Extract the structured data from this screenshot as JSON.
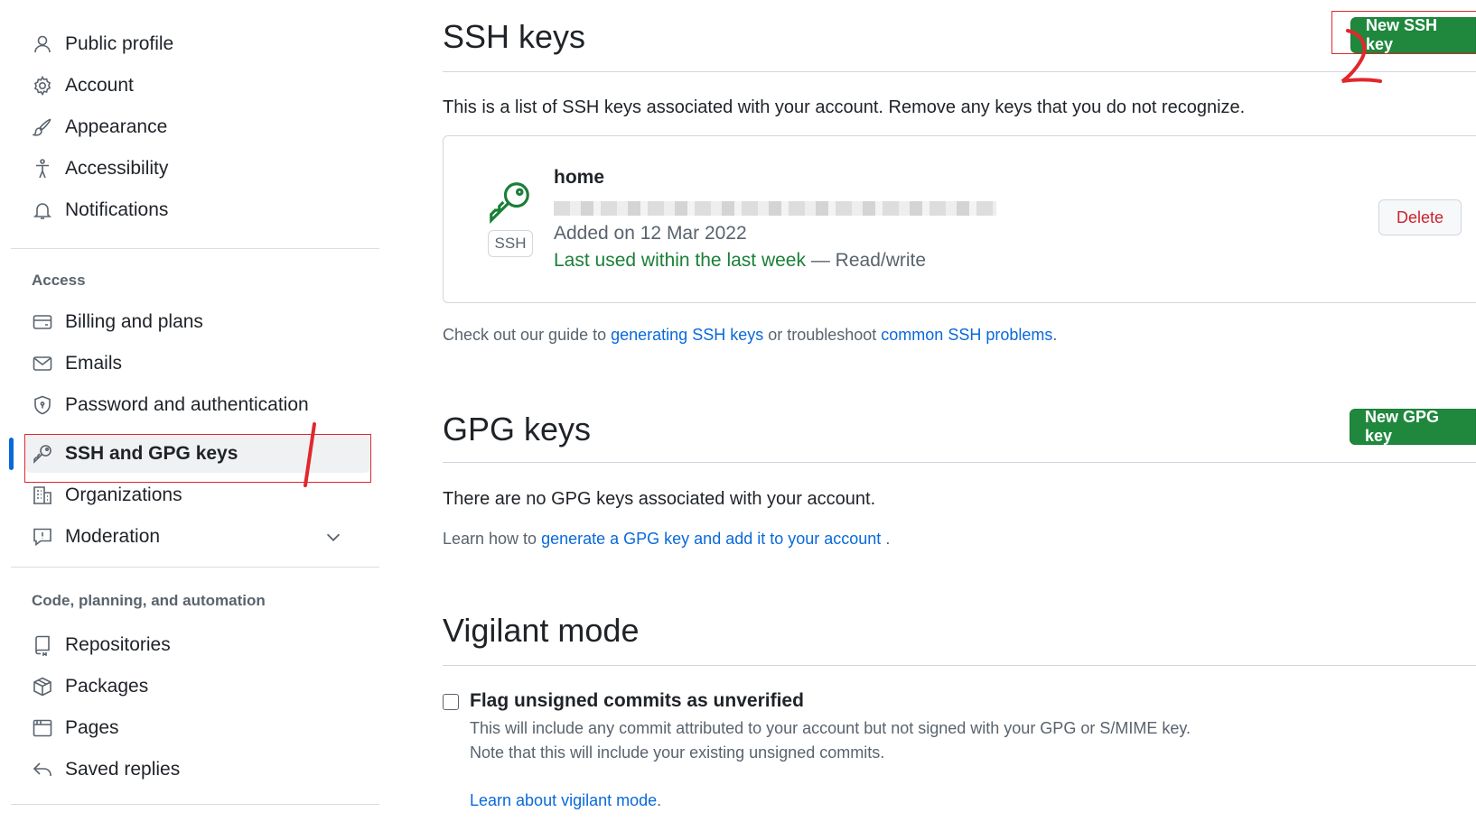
{
  "sidebar": {
    "items": [
      {
        "label": "Public profile",
        "icon": "person-icon"
      },
      {
        "label": "Account",
        "icon": "gear-icon"
      },
      {
        "label": "Appearance",
        "icon": "paintbrush-icon"
      },
      {
        "label": "Accessibility",
        "icon": "accessibility-icon"
      },
      {
        "label": "Notifications",
        "icon": "bell-icon"
      }
    ],
    "access_heading": "Access",
    "access_items": [
      {
        "label": "Billing and plans",
        "icon": "credit-card-icon"
      },
      {
        "label": "Emails",
        "icon": "mail-icon"
      },
      {
        "label": "Password and authentication",
        "icon": "shield-icon"
      },
      {
        "label": "SSH and GPG keys",
        "icon": "key-icon",
        "active": true
      },
      {
        "label": "Organizations",
        "icon": "organization-icon"
      },
      {
        "label": "Moderation",
        "icon": "report-icon"
      }
    ],
    "code_heading": "Code, planning, and automation",
    "code_items": [
      {
        "label": "Repositories",
        "icon": "repo-icon"
      },
      {
        "label": "Packages",
        "icon": "package-icon"
      },
      {
        "label": "Pages",
        "icon": "browser-icon"
      },
      {
        "label": "Saved replies",
        "icon": "reply-icon"
      }
    ]
  },
  "ssh": {
    "title": "SSH keys",
    "new_button": "New SSH key",
    "description": "This is a list of SSH keys associated with your account. Remove any keys that you do not recognize.",
    "key": {
      "name": "home",
      "badge": "SSH",
      "added": "Added on 12 Mar 2022",
      "last_used": "Last used within the last week",
      "access": " — Read/write",
      "delete_label": "Delete"
    },
    "guide_prefix": "Check out our guide to ",
    "guide_link1": "generating SSH keys",
    "guide_mid": " or troubleshoot ",
    "guide_link2": "common SSH problems",
    "guide_suffix": "."
  },
  "gpg": {
    "title": "GPG keys",
    "new_button": "New GPG key",
    "empty_text": "There are no GPG keys associated with your account.",
    "learn_prefix": "Learn how to ",
    "learn_link": "generate a GPG key and add it to your account",
    "learn_suffix": " ."
  },
  "vigilant": {
    "title": "Vigilant mode",
    "checkbox_label": "Flag unsigned commits as unverified",
    "desc1": "This will include any commit attributed to your account but not signed with your GPG or S/MIME key.",
    "desc2": "Note that this will include your existing unsigned commits.",
    "learn_link": "Learn about vigilant mode",
    "learn_suffix": "."
  },
  "colors": {
    "accent": "#0969da",
    "primary_button": "#1f883d",
    "danger": "#cf222e",
    "annotation": "#e0282d"
  }
}
